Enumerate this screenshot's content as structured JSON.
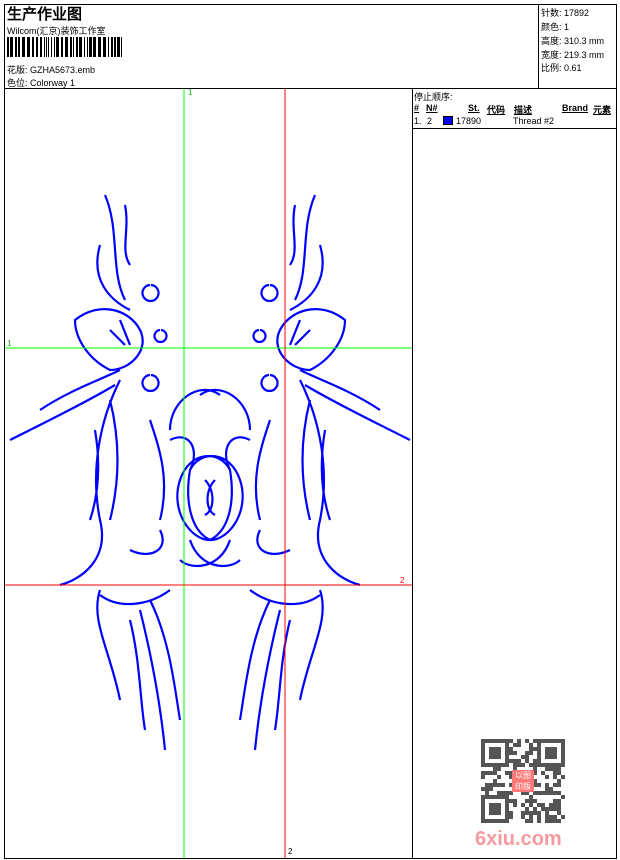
{
  "header": {
    "title": "生产作业图",
    "company": "Wilcom(汇京)装饰工作室",
    "design_label": "花版:",
    "design_value": "GZHA5673.emb",
    "colorway_label": "色位:",
    "colorway_value": "Colorway 1"
  },
  "info": {
    "stitches": "针数: 17892",
    "colors": "颜色: 1",
    "height": "高度: 310.3 mm",
    "width": "宽度: 219.3 mm",
    "scale": "比例: 0.61"
  },
  "stop_sequence": {
    "title": "停止顺序:",
    "columns": [
      "#",
      "N#",
      "St.",
      "代码",
      "描述",
      "Brand",
      "元素"
    ],
    "rows": [
      {
        "index": "1.",
        "needle": "2",
        "color": "#0000ff",
        "stitches": "17890",
        "description": "Thread #2"
      }
    ]
  },
  "guides": {
    "green_top": "1",
    "green_left": "1",
    "red_right": "2",
    "red_bottom": "2",
    "green_color": "#00ff00",
    "red_color": "#ff0000"
  },
  "design_color": "#0000ff",
  "watermark": {
    "text": "6xiu.com",
    "stamp_text": "以图印版"
  }
}
